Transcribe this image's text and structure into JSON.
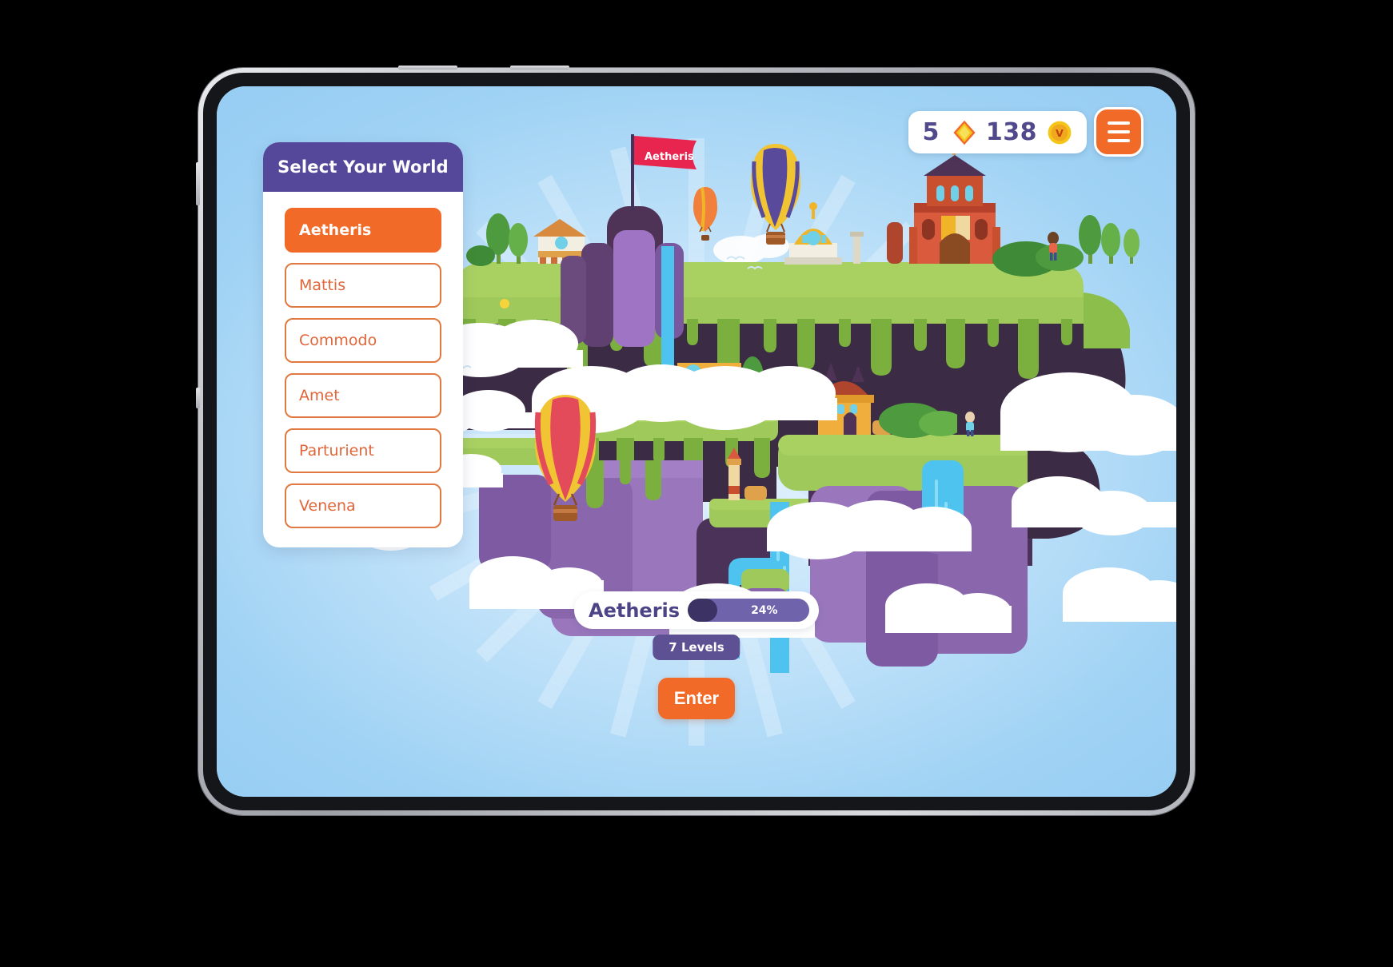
{
  "hud": {
    "gems": "5",
    "gem_icon": "gem-icon",
    "coins": "138",
    "coin_icon": "coin-icon",
    "coin_letter": "V",
    "menu_icon": "hamburger-menu-icon"
  },
  "sidebar": {
    "title": "Select Your World",
    "worlds": [
      {
        "label": "Aetheris",
        "selected": true
      },
      {
        "label": "Mattis",
        "selected": false
      },
      {
        "label": "Commodo",
        "selected": false
      },
      {
        "label": "Amet",
        "selected": false
      },
      {
        "label": "Parturient",
        "selected": false
      },
      {
        "label": "Venena",
        "selected": false
      }
    ]
  },
  "scene": {
    "flag_label": "Aetheris"
  },
  "footer": {
    "world_name": "Aetheris",
    "progress_percent": "24%",
    "progress_value": 24,
    "levels_label": "7 Levels",
    "enter_label": "Enter"
  },
  "colors": {
    "accent": "#f26a28",
    "purple": "#55489a",
    "progress_track": "#6f63ab",
    "progress_fill": "#3c3263",
    "sky": "#a8d6f5",
    "flag": "#e8254f"
  }
}
